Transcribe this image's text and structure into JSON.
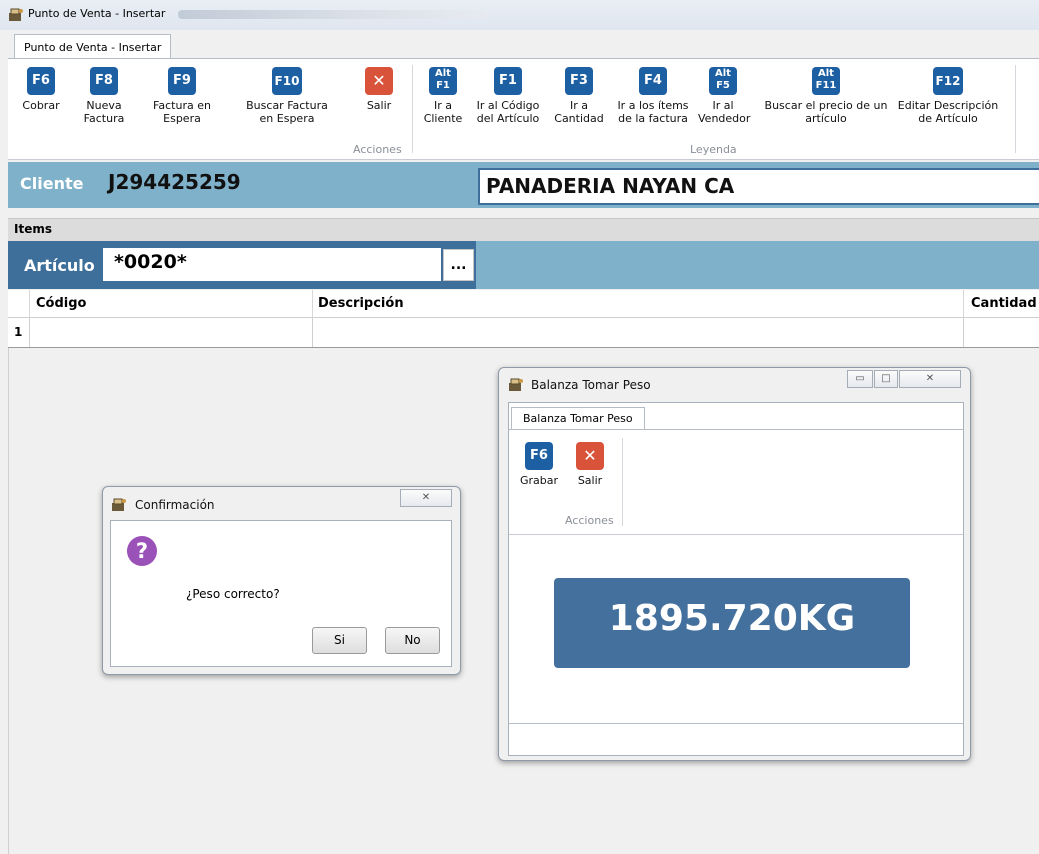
{
  "window": {
    "title": "Punto de Venta - Insertar",
    "tab": "Punto de Venta - Insertar"
  },
  "ribbon": {
    "buttons": [
      {
        "key": "F6",
        "label": "Cobrar"
      },
      {
        "key": "F8",
        "label": "Nueva Factura"
      },
      {
        "key": "F9",
        "label": "Factura en Espera"
      },
      {
        "key": "F10",
        "label": "Buscar Factura en Espera"
      },
      {
        "key": "x",
        "label": "Salir"
      },
      {
        "key": "Alt F1",
        "label": "Ir a Cliente"
      },
      {
        "key": "F1",
        "label": "Ir al Código del Artículo"
      },
      {
        "key": "F3",
        "label": "Ir a Cantidad"
      },
      {
        "key": "F4",
        "label": "Ir a los ítems de la factura"
      },
      {
        "key": "Alt F5",
        "label": "Ir al Vendedor"
      },
      {
        "key": "Alt F11",
        "label": "Buscar el precio de un artículo"
      },
      {
        "key": "F12",
        "label": "Editar Descripción de Artículo"
      }
    ],
    "groups": {
      "acciones": "Acciones",
      "leyenda": "Leyenda"
    }
  },
  "cliente": {
    "label": "Cliente",
    "code": "J294425259",
    "name": "PANADERIA NAYAN CA"
  },
  "items": {
    "section_label": "Items",
    "articulo_label": "Artículo",
    "articulo_value": "*0020*",
    "browse_label": "...",
    "columns": [
      "Código",
      "Descripción",
      "Cantidad"
    ],
    "row_number": "1"
  },
  "balanza": {
    "title": "Balanza Tomar Peso",
    "tab": "Balanza Tomar Peso",
    "buttons": [
      {
        "key": "F6",
        "label": "Grabar"
      },
      {
        "key": "x",
        "label": "Salir"
      }
    ],
    "group": "Acciones",
    "weight": "1895.720KG"
  },
  "confirmacion": {
    "title": "Confirmación",
    "message": "¿Peso correcto?",
    "yes": "Si",
    "no": "No"
  },
  "colors": {
    "key_blue": "#1d5fa3",
    "exit_red": "#d9533a",
    "header_blue": "#7fb2ca",
    "dark_blue": "#3e6e9a",
    "weight_bg": "#43709c",
    "question_purple": "#9a52b8"
  }
}
